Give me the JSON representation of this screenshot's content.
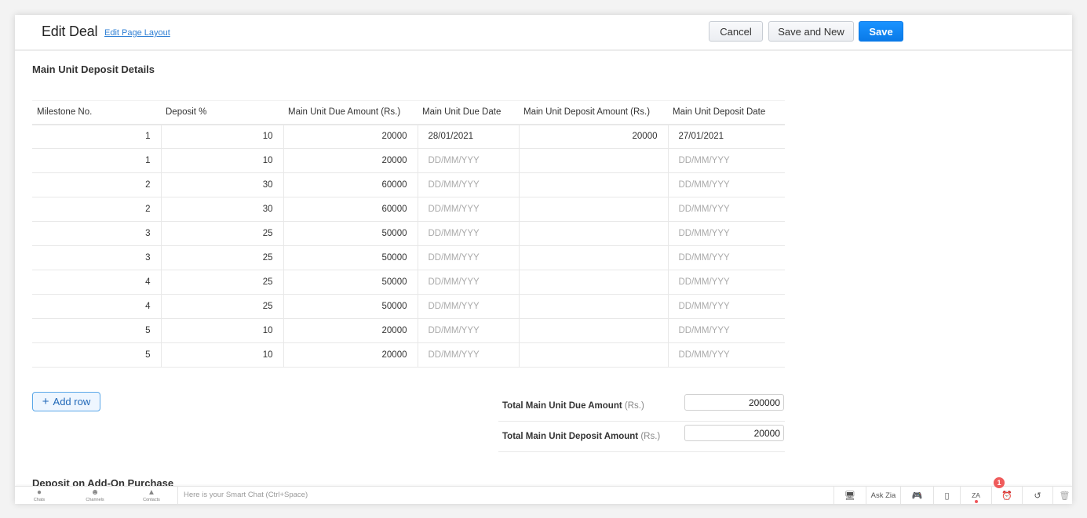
{
  "header": {
    "title": "Edit Deal",
    "edit_layout_link": "Edit Page Layout",
    "buttons": {
      "cancel": "Cancel",
      "save_and_new": "Save and New",
      "save": "Save"
    }
  },
  "section": {
    "title": "Main Unit Deposit Details",
    "columns": [
      "Milestone No.",
      "Deposit %",
      "Main Unit Due Amount (Rs.)",
      "Main Unit Due Date",
      "Main Unit Deposit Amount (Rs.)",
      "Main Unit Deposit Date"
    ],
    "date_placeholder": "DD/MM/YYY",
    "rows": [
      {
        "milestone": "1",
        "deposit_pct": "10",
        "due_amount": "20000",
        "due_date": "28/01/2021",
        "deposit_amount": "20000",
        "deposit_date": "27/01/2021"
      },
      {
        "milestone": "1",
        "deposit_pct": "10",
        "due_amount": "20000",
        "due_date": "",
        "deposit_amount": "",
        "deposit_date": ""
      },
      {
        "milestone": "2",
        "deposit_pct": "30",
        "due_amount": "60000",
        "due_date": "",
        "deposit_amount": "",
        "deposit_date": ""
      },
      {
        "milestone": "2",
        "deposit_pct": "30",
        "due_amount": "60000",
        "due_date": "",
        "deposit_amount": "",
        "deposit_date": ""
      },
      {
        "milestone": "3",
        "deposit_pct": "25",
        "due_amount": "50000",
        "due_date": "",
        "deposit_amount": "",
        "deposit_date": ""
      },
      {
        "milestone": "3",
        "deposit_pct": "25",
        "due_amount": "50000",
        "due_date": "",
        "deposit_amount": "",
        "deposit_date": ""
      },
      {
        "milestone": "4",
        "deposit_pct": "25",
        "due_amount": "50000",
        "due_date": "",
        "deposit_amount": "",
        "deposit_date": ""
      },
      {
        "milestone": "4",
        "deposit_pct": "25",
        "due_amount": "50000",
        "due_date": "",
        "deposit_amount": "",
        "deposit_date": ""
      },
      {
        "milestone": "5",
        "deposit_pct": "10",
        "due_amount": "20000",
        "due_date": "",
        "deposit_amount": "",
        "deposit_date": ""
      },
      {
        "milestone": "5",
        "deposit_pct": "10",
        "due_amount": "20000",
        "due_date": "",
        "deposit_amount": "",
        "deposit_date": ""
      }
    ],
    "add_row": "Add row",
    "totals": [
      {
        "label": "Total Main Unit Due Amount",
        "unit": "(Rs.)",
        "value": "200000"
      },
      {
        "label": "Total Main Unit Deposit Amount",
        "unit": "(Rs.)",
        "value": "20000"
      }
    ]
  },
  "next_section_title": "Deposit on Add-On Purchase",
  "bottom_bar": {
    "nav": [
      {
        "label": "Chats",
        "icon": "chat-bubble-icon"
      },
      {
        "label": "Channels",
        "icon": "group-icon"
      },
      {
        "label": "Contacts",
        "icon": "person-icon"
      }
    ],
    "smart_chat_placeholder": "Here is your Smart Chat (Ctrl+Space)",
    "ask_zia": "Ask Zia",
    "za_label": "ZA",
    "alarm_badge": "1"
  }
}
